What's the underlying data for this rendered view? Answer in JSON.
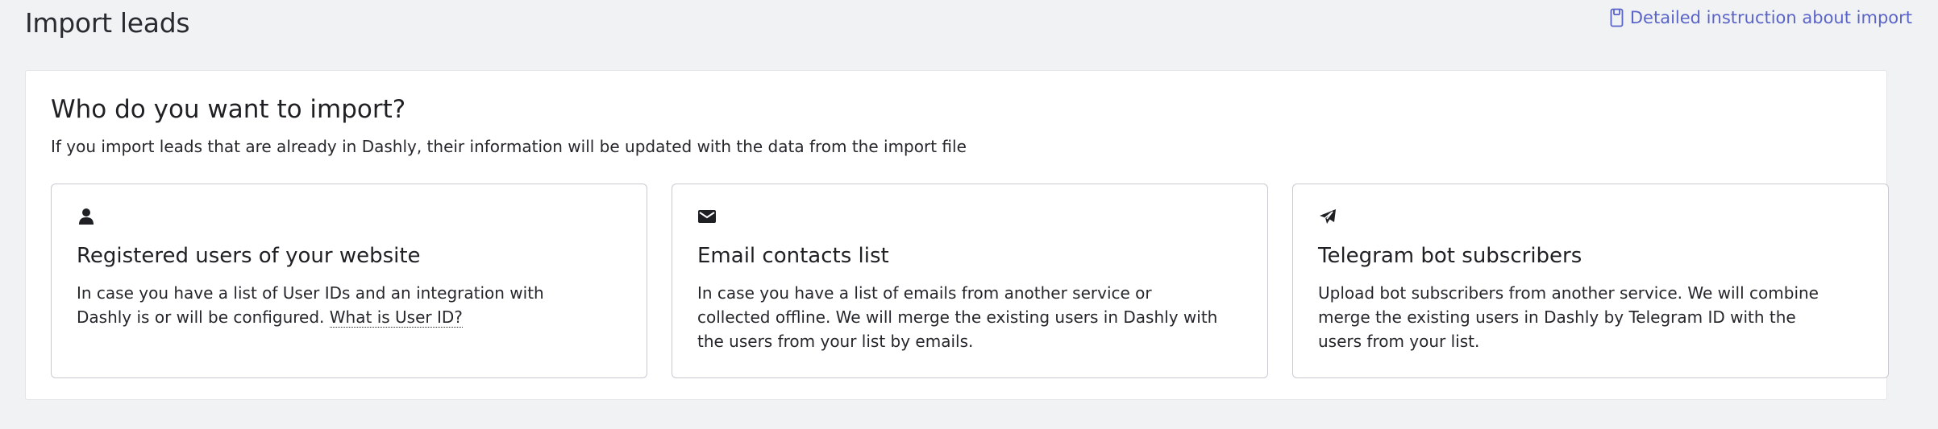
{
  "header": {
    "title": "Import leads",
    "instruction_link": "Detailed instruction about import",
    "instruction_icon": "book-icon"
  },
  "panel": {
    "title": "Who do you want to import?",
    "subtitle": "If you import leads that are already in Dashly, their information will be updated with the data from the import file"
  },
  "cards": [
    {
      "icon": "user-icon",
      "title": "Registered users of your website",
      "desc": "In case you have a list of User IDs and an integration with Dashly is or will be configured.",
      "link": "What is User ID?"
    },
    {
      "icon": "envelope-icon",
      "title": "Email contacts list",
      "desc": "In case you have a list of emails from another service or collected offline. We will merge the existing users in Dashly with the users from your list by emails."
    },
    {
      "icon": "telegram-icon",
      "title": "Telegram bot subscribers",
      "desc": "Upload bot subscribers from another service. We will combine merge the existing users in Dashly by Telegram ID with the users from your list."
    }
  ],
  "colors": {
    "link": "#5b64c9",
    "background": "#f1f2f4",
    "card_border": "#c9cad1"
  }
}
